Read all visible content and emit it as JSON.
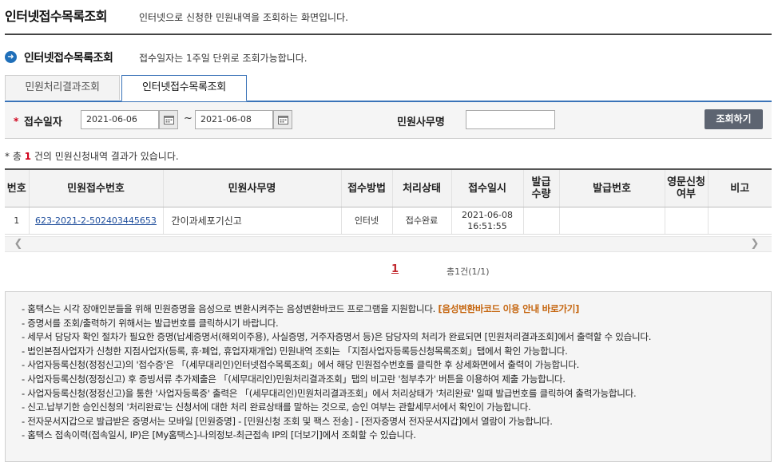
{
  "header": {
    "title": "인터넷접수목록조회",
    "description": "인터넷으로 신청한 민원내역을 조회하는 화면입니다."
  },
  "section": {
    "title": "인터넷접수목록조회",
    "note": "접수일자는 1주일 단위로 조회가능합니다."
  },
  "tabs": [
    {
      "label": "민원처리결과조회",
      "active": false
    },
    {
      "label": "인터넷접수목록조회",
      "active": true
    }
  ],
  "search": {
    "required_mark": "*",
    "date_label": "접수일자",
    "date_from": "2021-06-06",
    "date_sep": "~",
    "date_to": "2021-06-08",
    "office_label": "민원사무명",
    "office_value": "",
    "button_label": "조회하기"
  },
  "result": {
    "prefix": "* 총 ",
    "count": "1",
    "suffix": " 건의 민원신청내역 결과가 있습니다."
  },
  "table": {
    "headers": [
      "번호",
      "민원접수번호",
      "민원사무명",
      "접수방법",
      "처리상태",
      "접수일시",
      "발급\n수량",
      "발급번호",
      "영문신청\n여부",
      "비고"
    ],
    "rows": [
      {
        "no": "1",
        "receipt_no": "623-2021-2-502403445653",
        "office": "간이과세포기신고",
        "method": "인터넷",
        "status": "접수완료",
        "date": "2021-06-08",
        "time": "16:51:55",
        "qty": "",
        "issue_no": "",
        "english": "",
        "remark": ""
      }
    ]
  },
  "pager": {
    "current": "1",
    "total": "총1건(1/1)"
  },
  "info": {
    "lines": [
      {
        "text": "- 홈택스는 시각 장애인분들을 위해 민원증명을 음성으로 변환시켜주는 음성변환바코드 프로그램을 지원합니다.",
        "link": "[음성변환바코드 이용 안내 바로가기]"
      },
      {
        "text": "- 증명서를 조회/출력하기 위해서는 발급번호를 클릭하시기 바랍니다."
      },
      {
        "text": "- 세무서 담당자 확인 절차가 필요한 증명(납세증명서(해외이주용), 사실증명, 거주자증명서 등)은 담당자의 처리가 완료되면 [민원처리결과조회]에서 출력할 수 있습니다."
      },
      {
        "text": "- 법인본점사업자가 신청한 지점사업자(등록, 휴·폐업, 휴업자재개업) 민원내역 조회는 「지점사업자등록등신청목록조회」탭에서 확인 가능합니다."
      },
      {
        "text": "- 사업자등록신청(정정신고)의 '접수증'은  「(세무대리인)인터넷접수목록조회」에서 해당 민원접수번호를 클릭한 후 상세화면에서 출력이 가능합니다."
      },
      {
        "text": "- 사업자등록신청(정정신고) 후 증빙서류 추가제출은  「(세무대리인)민원처리결과조회」탭의 비고란 '첨부추가' 버튼을 이용하여 제출 가능합니다."
      },
      {
        "text": "- 사업자등록신청(정정신고)을 통한 '사업자등록증' 출력은  「(세무대리인)민원처리결과조회」에서 처리상태가 '처리완료' 일때 발급번호를 클릭하여 출력가능합니다."
      },
      {
        "text": "- 신고.납부기한 승인신청의 '처리완료'는 신청서에 대한 처리 완료상태를 말하는 것으로, 승인 여부는 관할세무서에서 확인이 가능합니다."
      },
      {
        "text": "- 전자문서지갑으로 발급받은 증명서는 모바일 [민원증명] - [민원신청 조회 및 팩스 전송] - [전자증명서 전자문서지갑]에서 열람이 가능합니다."
      },
      {
        "text": "- 홈택스 접속이력(접속일시, IP)은 [My홈택스]-나의정보-최근접속 IP의 [더보기]에서 조회할 수 있습니다."
      }
    ]
  }
}
